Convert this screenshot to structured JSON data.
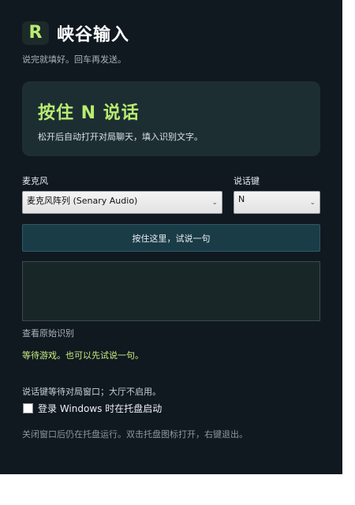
{
  "header": {
    "logo_letter": "R",
    "title": "峡谷输入",
    "subtitle": "说完就填好。回车再发送。"
  },
  "hero": {
    "title": "按住 N 说话",
    "subtitle": "松开后自动打开对局聊天，填入识别文字。"
  },
  "microphone": {
    "label": "麦克风",
    "selected": "麦克风阵列 (Senary Audio)"
  },
  "hotkey": {
    "label": "说话键",
    "selected": "N"
  },
  "push_to_talk": {
    "label": "按住这里，试说一句"
  },
  "transcript": {
    "value": ""
  },
  "raw_link": "查看原始识别",
  "status": "等待游戏。也可以先试说一句。",
  "hotkey_note": "说话键等待对局窗口；大厅不启用。",
  "autostart": {
    "label": "登录 Windows 时在托盘启动",
    "checked": false
  },
  "footer": "关闭窗口后仍在托盘运行。双击托盘图标打开，右键退出。",
  "colors": {
    "background": "#101820",
    "accent": "#b8ec72",
    "panel": "#1d2e32",
    "button": "#1a3c47"
  }
}
